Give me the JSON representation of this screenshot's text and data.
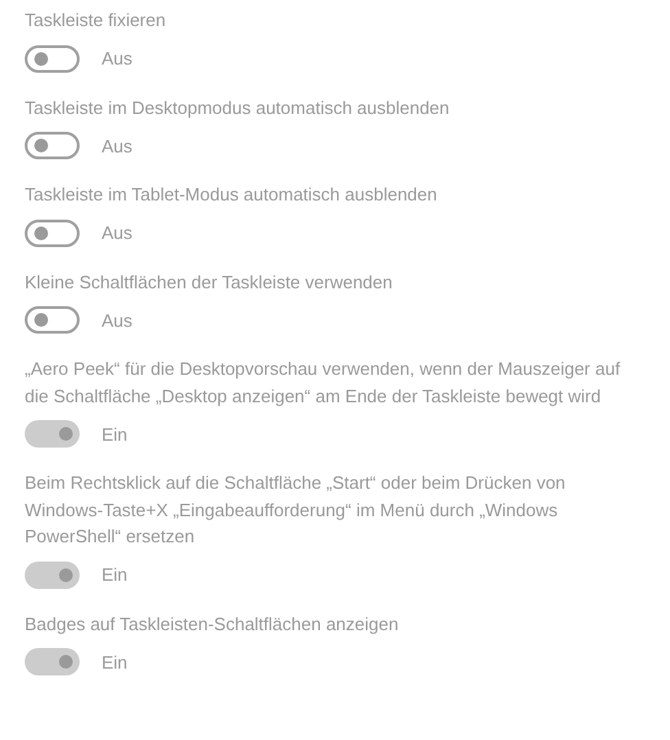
{
  "settings": [
    {
      "label": "Taskleiste fixieren",
      "on": false,
      "disabled": true,
      "state_text": "Aus"
    },
    {
      "label": "Taskleiste im Desktopmodus automatisch ausblenden",
      "on": false,
      "disabled": true,
      "state_text": "Aus"
    },
    {
      "label": "Taskleiste im Tablet-Modus automatisch ausblenden",
      "on": false,
      "disabled": true,
      "state_text": "Aus"
    },
    {
      "label": "Kleine Schaltflächen der Taskleiste verwenden",
      "on": false,
      "disabled": true,
      "state_text": "Aus"
    },
    {
      "label": "„Aero Peek“ für die Desktopvorschau verwenden, wenn der Mauszeiger auf die Schaltfläche „Desktop anzeigen“ am Ende der Taskleiste bewegt wird",
      "on": true,
      "disabled": true,
      "state_text": "Ein"
    },
    {
      "label": "Beim Rechtsklick auf die Schaltfläche „Start“ oder beim Drücken von Windows-Taste+X „Eingabeaufforderung“ im Menü durch „Windows PowerShell“ ersetzen",
      "on": true,
      "disabled": true,
      "state_text": "Ein"
    },
    {
      "label": "Badges auf Taskleisten-Schaltflächen anzeigen",
      "on": true,
      "disabled": true,
      "state_text": "Ein"
    }
  ]
}
